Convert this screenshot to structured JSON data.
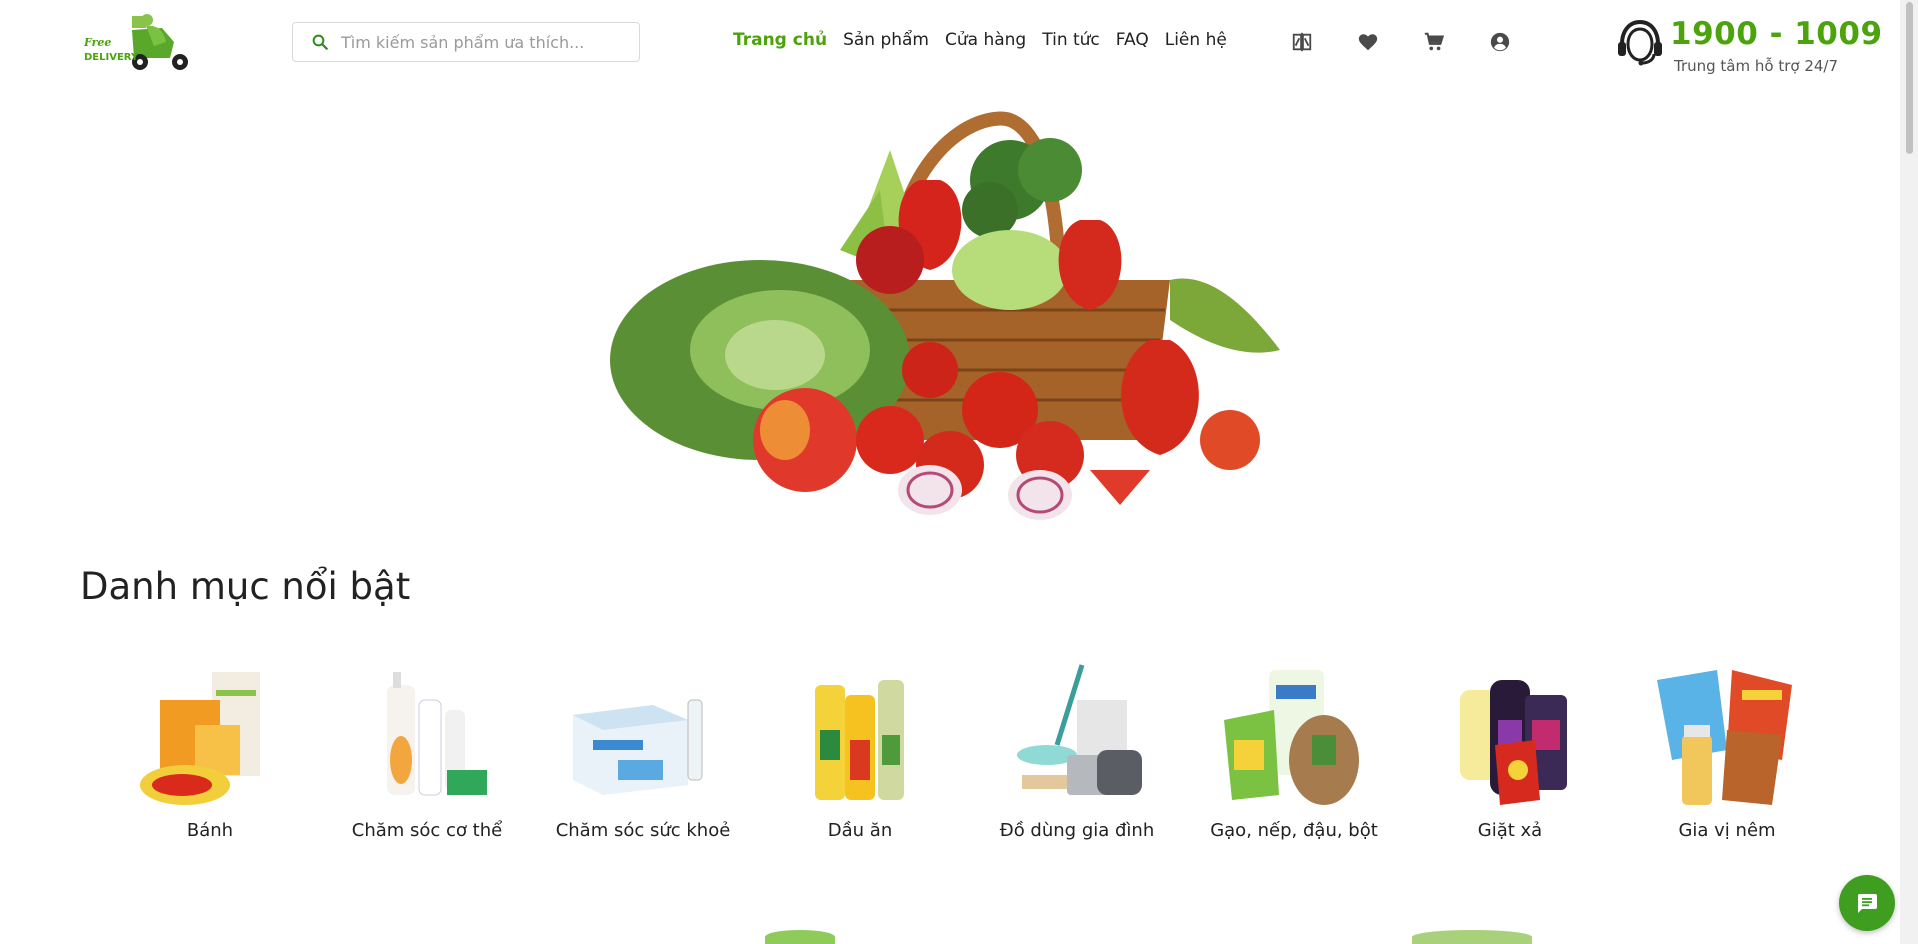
{
  "brand": {
    "logo_text_top": "Free",
    "logo_text_bottom": "DELIVERY"
  },
  "search": {
    "placeholder": "Tìm kiếm sản phẩm ưa thích...",
    "value": ""
  },
  "nav": {
    "items": [
      {
        "label": "Trang chủ",
        "active": true
      },
      {
        "label": "Sản phẩm",
        "active": false
      },
      {
        "label": "Cửa hàng",
        "active": false
      },
      {
        "label": "Tin tức",
        "active": false
      },
      {
        "label": "FAQ",
        "active": false
      },
      {
        "label": "Liên hệ",
        "active": false
      }
    ]
  },
  "header_icons": [
    "compare-icon",
    "heart-icon",
    "cart-icon",
    "account-icon"
  ],
  "hotline": {
    "phone": "1900 - 1009",
    "subtitle": "Trung tâm hỗ trợ 24/7"
  },
  "featured": {
    "title": "Danh mục nổi bật",
    "categories": [
      {
        "label": "Bánh"
      },
      {
        "label": "Chăm sóc cơ thể"
      },
      {
        "label": "Chăm sóc sức khoẻ"
      },
      {
        "label": "Dầu ăn"
      },
      {
        "label": "Đồ dùng gia đình"
      },
      {
        "label": "Gạo, nếp, đậu, bột"
      },
      {
        "label": "Giặt xả"
      },
      {
        "label": "Gia vị nêm"
      }
    ]
  },
  "colors": {
    "accent": "#4ca30d",
    "chat_button": "#3f9d1f"
  }
}
